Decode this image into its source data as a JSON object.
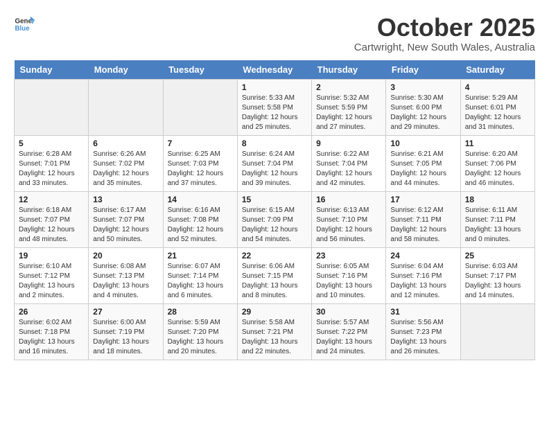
{
  "logo": {
    "line1": "General",
    "line2": "Blue"
  },
  "title": "October 2025",
  "subtitle": "Cartwright, New South Wales, Australia",
  "days_header": [
    "Sunday",
    "Monday",
    "Tuesday",
    "Wednesday",
    "Thursday",
    "Friday",
    "Saturday"
  ],
  "weeks": [
    [
      {
        "day": "",
        "info": ""
      },
      {
        "day": "",
        "info": ""
      },
      {
        "day": "",
        "info": ""
      },
      {
        "day": "1",
        "info": "Sunrise: 5:33 AM\nSunset: 5:58 PM\nDaylight: 12 hours\nand 25 minutes."
      },
      {
        "day": "2",
        "info": "Sunrise: 5:32 AM\nSunset: 5:59 PM\nDaylight: 12 hours\nand 27 minutes."
      },
      {
        "day": "3",
        "info": "Sunrise: 5:30 AM\nSunset: 6:00 PM\nDaylight: 12 hours\nand 29 minutes."
      },
      {
        "day": "4",
        "info": "Sunrise: 5:29 AM\nSunset: 6:01 PM\nDaylight: 12 hours\nand 31 minutes."
      }
    ],
    [
      {
        "day": "5",
        "info": "Sunrise: 6:28 AM\nSunset: 7:01 PM\nDaylight: 12 hours\nand 33 minutes."
      },
      {
        "day": "6",
        "info": "Sunrise: 6:26 AM\nSunset: 7:02 PM\nDaylight: 12 hours\nand 35 minutes."
      },
      {
        "day": "7",
        "info": "Sunrise: 6:25 AM\nSunset: 7:03 PM\nDaylight: 12 hours\nand 37 minutes."
      },
      {
        "day": "8",
        "info": "Sunrise: 6:24 AM\nSunset: 7:04 PM\nDaylight: 12 hours\nand 39 minutes."
      },
      {
        "day": "9",
        "info": "Sunrise: 6:22 AM\nSunset: 7:04 PM\nDaylight: 12 hours\nand 42 minutes."
      },
      {
        "day": "10",
        "info": "Sunrise: 6:21 AM\nSunset: 7:05 PM\nDaylight: 12 hours\nand 44 minutes."
      },
      {
        "day": "11",
        "info": "Sunrise: 6:20 AM\nSunset: 7:06 PM\nDaylight: 12 hours\nand 46 minutes."
      }
    ],
    [
      {
        "day": "12",
        "info": "Sunrise: 6:18 AM\nSunset: 7:07 PM\nDaylight: 12 hours\nand 48 minutes."
      },
      {
        "day": "13",
        "info": "Sunrise: 6:17 AM\nSunset: 7:07 PM\nDaylight: 12 hours\nand 50 minutes."
      },
      {
        "day": "14",
        "info": "Sunrise: 6:16 AM\nSunset: 7:08 PM\nDaylight: 12 hours\nand 52 minutes."
      },
      {
        "day": "15",
        "info": "Sunrise: 6:15 AM\nSunset: 7:09 PM\nDaylight: 12 hours\nand 54 minutes."
      },
      {
        "day": "16",
        "info": "Sunrise: 6:13 AM\nSunset: 7:10 PM\nDaylight: 12 hours\nand 56 minutes."
      },
      {
        "day": "17",
        "info": "Sunrise: 6:12 AM\nSunset: 7:11 PM\nDaylight: 12 hours\nand 58 minutes."
      },
      {
        "day": "18",
        "info": "Sunrise: 6:11 AM\nSunset: 7:11 PM\nDaylight: 13 hours\nand 0 minutes."
      }
    ],
    [
      {
        "day": "19",
        "info": "Sunrise: 6:10 AM\nSunset: 7:12 PM\nDaylight: 13 hours\nand 2 minutes."
      },
      {
        "day": "20",
        "info": "Sunrise: 6:08 AM\nSunset: 7:13 PM\nDaylight: 13 hours\nand 4 minutes."
      },
      {
        "day": "21",
        "info": "Sunrise: 6:07 AM\nSunset: 7:14 PM\nDaylight: 13 hours\nand 6 minutes."
      },
      {
        "day": "22",
        "info": "Sunrise: 6:06 AM\nSunset: 7:15 PM\nDaylight: 13 hours\nand 8 minutes."
      },
      {
        "day": "23",
        "info": "Sunrise: 6:05 AM\nSunset: 7:16 PM\nDaylight: 13 hours\nand 10 minutes."
      },
      {
        "day": "24",
        "info": "Sunrise: 6:04 AM\nSunset: 7:16 PM\nDaylight: 13 hours\nand 12 minutes."
      },
      {
        "day": "25",
        "info": "Sunrise: 6:03 AM\nSunset: 7:17 PM\nDaylight: 13 hours\nand 14 minutes."
      }
    ],
    [
      {
        "day": "26",
        "info": "Sunrise: 6:02 AM\nSunset: 7:18 PM\nDaylight: 13 hours\nand 16 minutes."
      },
      {
        "day": "27",
        "info": "Sunrise: 6:00 AM\nSunset: 7:19 PM\nDaylight: 13 hours\nand 18 minutes."
      },
      {
        "day": "28",
        "info": "Sunrise: 5:59 AM\nSunset: 7:20 PM\nDaylight: 13 hours\nand 20 minutes."
      },
      {
        "day": "29",
        "info": "Sunrise: 5:58 AM\nSunset: 7:21 PM\nDaylight: 13 hours\nand 22 minutes."
      },
      {
        "day": "30",
        "info": "Sunrise: 5:57 AM\nSunset: 7:22 PM\nDaylight: 13 hours\nand 24 minutes."
      },
      {
        "day": "31",
        "info": "Sunrise: 5:56 AM\nSunset: 7:23 PM\nDaylight: 13 hours\nand 26 minutes."
      },
      {
        "day": "",
        "info": ""
      }
    ]
  ]
}
